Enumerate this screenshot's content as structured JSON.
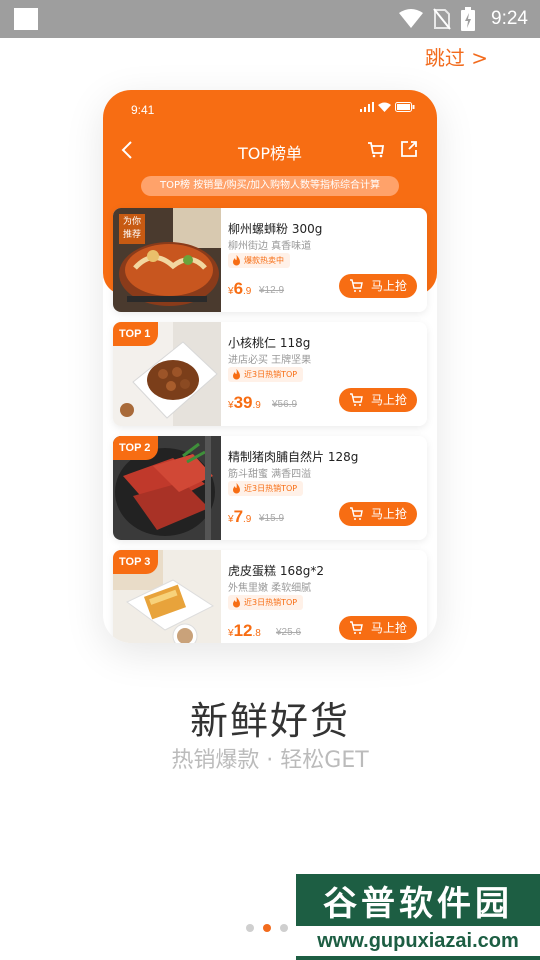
{
  "status_bar": {
    "time": "9:24"
  },
  "skip_label": "跳过 >",
  "phone": {
    "time": "9:41",
    "title": "TOP榜单",
    "banner": "TOP榜 按销量/购买/加入购物人数等指标综合计算",
    "products": [
      {
        "rank": "",
        "badge": [
          "为你",
          "推荐"
        ],
        "name": "柳州螺蛳粉 300g",
        "desc": "柳州街边 真香味道",
        "tag": "爆款热卖中",
        "price_int": "6",
        "price_dec": ".9",
        "orig_price": "¥12.9",
        "buy": "马上抢"
      },
      {
        "rank": "TOP 1",
        "name": "小核桃仁 118g",
        "desc": "进店必买 王牌坚果",
        "tag": "近3日热销TOP",
        "price_int": "39",
        "price_dec": ".9",
        "orig_price": "¥56.9",
        "buy": "马上抢"
      },
      {
        "rank": "TOP 2",
        "name": "精制猪肉脯自然片 128g",
        "desc": "筋斗甜蜜 满香四溢",
        "tag": "近3日热销TOP",
        "price_int": "7",
        "price_dec": ".9",
        "orig_price": "¥15.9",
        "buy": "马上抢"
      },
      {
        "rank": "TOP 3",
        "name": "虎皮蛋糕 168g*2",
        "desc": "外焦里嫩 柔软细腻",
        "tag": "近3日热销TOP",
        "price_int": "12",
        "price_dec": ".8",
        "orig_price": "¥25.6",
        "buy": "马上抢"
      }
    ],
    "currency": "¥"
  },
  "headline": "新鲜好货",
  "subline": "热销爆款 · 轻松GET",
  "pager": {
    "pages": 3,
    "active": 2
  },
  "watermark": {
    "title": "谷普软件园",
    "url": "www.gupuxiazai.com"
  },
  "colors": {
    "accent": "#f76d13",
    "status_bar": "#9e9e9e"
  },
  "icons": [
    "wifi-icon",
    "no-sim-icon",
    "battery-icon",
    "back-icon",
    "cart-icon",
    "share-icon",
    "flame-icon"
  ]
}
